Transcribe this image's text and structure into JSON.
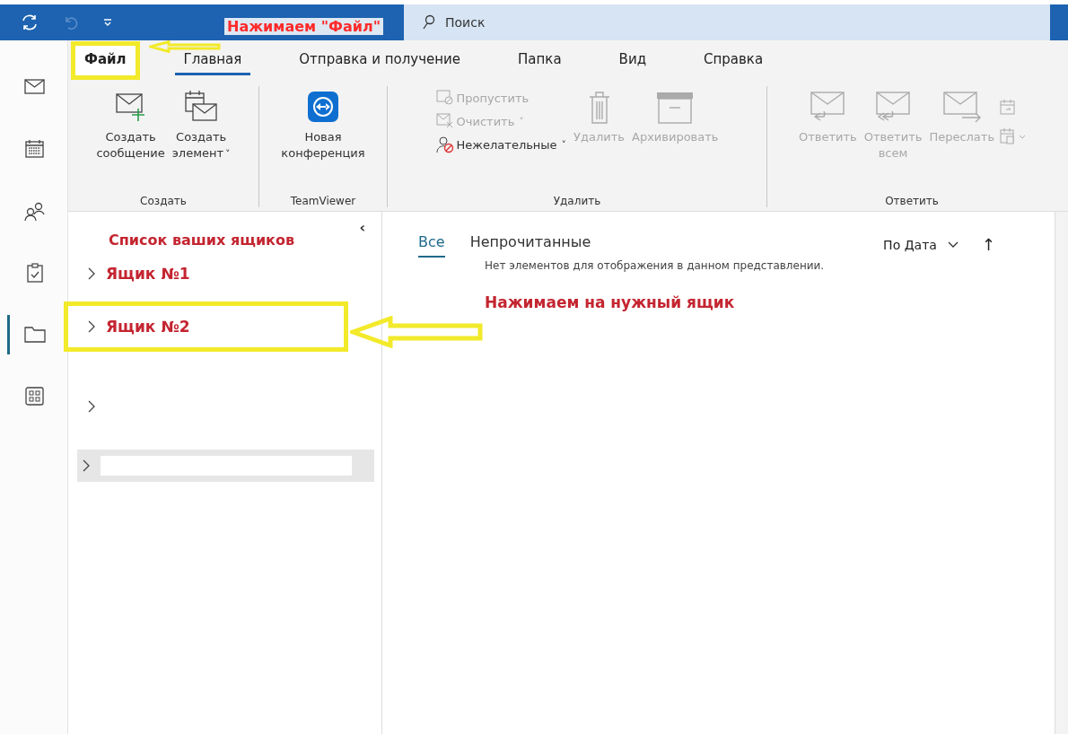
{
  "title_bar": {
    "search": {
      "placeholder": "Поиск"
    },
    "annotation": "Нажимаем \"Файл\""
  },
  "nav_rail": [
    {
      "kind": "mail",
      "selected": false
    },
    {
      "kind": "calendar",
      "selected": false
    },
    {
      "kind": "people",
      "selected": false
    },
    {
      "kind": "tasks",
      "selected": false
    },
    {
      "kind": "folders",
      "selected": true
    },
    {
      "kind": "apps",
      "selected": false
    }
  ],
  "ribbon": {
    "tabs": [
      {
        "label": "Файл",
        "selected": false,
        "highlighted": true
      },
      {
        "label": "Главная",
        "selected": true,
        "highlighted": false
      },
      {
        "label": "Отправка и получение",
        "selected": false,
        "highlighted": false
      },
      {
        "label": "Папка",
        "selected": false,
        "highlighted": false
      },
      {
        "label": "Вид",
        "selected": false,
        "highlighted": false
      },
      {
        "label": "Справка",
        "selected": false,
        "highlighted": false
      }
    ],
    "groups": [
      {
        "label": "Создать",
        "items": [
          {
            "kind": "new-mail",
            "label": "Создать сообщение",
            "disabled": false
          },
          {
            "kind": "new-item",
            "label": "Создать элемент",
            "caret": "˅",
            "disabled": false
          }
        ]
      },
      {
        "label": "TeamViewer",
        "items": [
          {
            "kind": "teamviewer",
            "label": "Новая конференция",
            "disabled": false
          }
        ]
      },
      {
        "label": "Удалить",
        "items": [
          {
            "kind": "small-stack",
            "children": [
              {
                "kind": "ignore",
                "label": "Пропустить",
                "disabled": true
              },
              {
                "kind": "cleanup",
                "label": "Очистить",
                "caret": "˅",
                "disabled": true
              },
              {
                "kind": "junk",
                "label": "Нежелательные",
                "caret": "˅",
                "disabled": false
              }
            ]
          },
          {
            "kind": "delete",
            "label": "Удалить",
            "disabled": true
          },
          {
            "kind": "archive",
            "label": "Архивировать",
            "disabled": true
          }
        ]
      },
      {
        "label": "Ответить",
        "items": [
          {
            "kind": "reply",
            "label": "Ответить",
            "disabled": true
          },
          {
            "kind": "reply-all",
            "label": "Ответить всем",
            "disabled": true
          },
          {
            "kind": "forward",
            "label": "Переслать",
            "disabled": true
          },
          {
            "kind": "meeting-stack"
          }
        ]
      }
    ]
  },
  "folder_pane": {
    "collapse": "‹",
    "annotation": "Список ваших ящиков",
    "folders": [
      {
        "label": "Ящик №1",
        "selected": false,
        "highlighted": false
      },
      {
        "label": "Ящик №2",
        "selected": false,
        "highlighted": true
      },
      {
        "selected": false,
        "highlighted": false
      },
      {
        "selected": true,
        "highlighted": false
      }
    ]
  },
  "message_list": {
    "filters": [
      {
        "label": "Все",
        "selected": true
      },
      {
        "label": "Непрочитанные",
        "selected": false
      }
    ],
    "sort": "По Дата",
    "sort_direction": "↑",
    "empty_message": "Нет элементов для отображения в данном представлении.",
    "annotation": "Нажимаем на нужный ящик"
  }
}
